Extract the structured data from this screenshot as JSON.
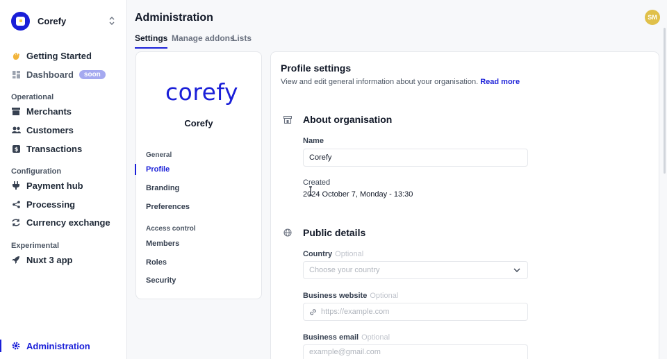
{
  "sidebar": {
    "brand": "Corefy",
    "items": {
      "getting_started": "Getting Started",
      "dashboard": "Dashboard",
      "dashboard_badge": "soon",
      "section_operational": "Operational",
      "merchants": "Merchants",
      "customers": "Customers",
      "transactions": "Transactions",
      "section_configuration": "Configuration",
      "payment_hub": "Payment hub",
      "processing": "Processing",
      "currency_exchange": "Currency exchange",
      "section_experimental": "Experimental",
      "nuxt_app": "Nuxt 3 app",
      "administration": "Administration"
    }
  },
  "header": {
    "title": "Administration",
    "avatar_initials": "SM",
    "tabs": [
      "Settings",
      "Manage addons",
      "Lists"
    ]
  },
  "left_panel": {
    "wordmark": "corefy",
    "org_name": "Corefy",
    "section_general": "General",
    "profile": "Profile",
    "branding": "Branding",
    "preferences": "Preferences",
    "section_access": "Access control",
    "members": "Members",
    "roles": "Roles",
    "security": "Security"
  },
  "main": {
    "title": "Profile settings",
    "description": "View and edit general information about your organisation.",
    "read_more": "Read more",
    "about_title": "About organisation",
    "name_label": "Name",
    "name_value": "Corefy",
    "created_label": "Created",
    "created_value": "2024 October 7, Monday - 13:30",
    "public_title": "Public details",
    "country_label": "Country",
    "optional": "Optional",
    "country_placeholder": "Choose your country",
    "website_label": "Business website",
    "website_placeholder": "https://example.com",
    "email_label": "Business email",
    "email_placeholder": "example@gmail.com"
  },
  "colors": {
    "accent": "#1a1fd8",
    "avatar": "#e0c04a",
    "badge": "#a5a9f0"
  },
  "icons": [
    "wave-hand-icon",
    "dashboard-icon",
    "store-icon",
    "users-icon",
    "dollar-icon",
    "plug-icon",
    "share-icon",
    "exchange-icon",
    "rocket-icon",
    "gear-icon",
    "chevron-up-down-icon",
    "building-icon",
    "globe-icon",
    "link-icon",
    "chevron-down-icon"
  ]
}
